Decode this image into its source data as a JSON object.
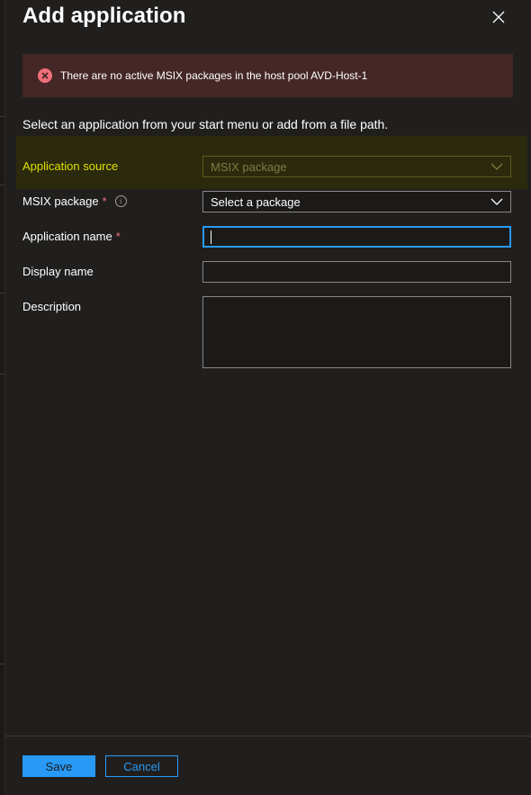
{
  "panel": {
    "title": "Add application"
  },
  "error": {
    "message": "There are no active MSIX packages in the host pool AVD-Host-1"
  },
  "intro": "Select an application from your start menu or add from a file path.",
  "form": {
    "app_source": {
      "label": "Application source",
      "value": "MSIX package"
    },
    "msix_package": {
      "label": "MSIX package",
      "required_mark": "*",
      "value": "Select a package"
    },
    "app_name": {
      "label": "Application name",
      "required_mark": "*",
      "value": ""
    },
    "display_name": {
      "label": "Display name",
      "value": ""
    },
    "description": {
      "label": "Description",
      "value": ""
    }
  },
  "footer": {
    "save_label": "Save",
    "cancel_label": "Cancel"
  },
  "colors": {
    "accent": "#2899f5",
    "highlight_label": "#e0e000",
    "error_bg": "#442726",
    "error_icon": "#f1707b"
  }
}
